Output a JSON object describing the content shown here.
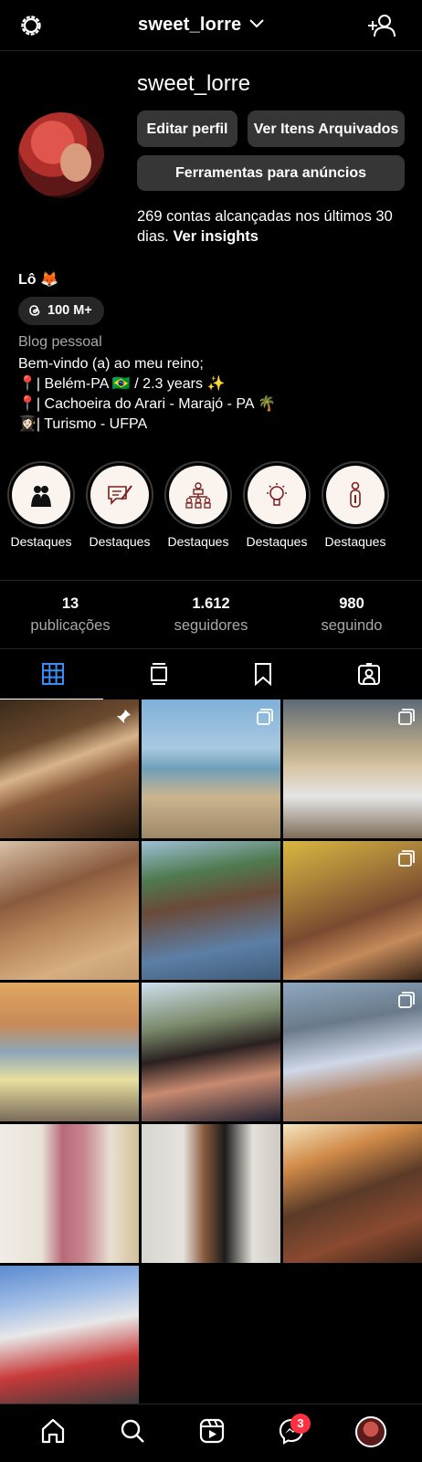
{
  "header": {
    "username": "sweet_lorre",
    "icons": [
      "settings-gear-icon",
      "chevron-down-icon",
      "add-person-icon"
    ]
  },
  "profile": {
    "display_username": "sweet_lorre",
    "edit_button": "Editar perfil",
    "archive_button": "Ver Itens Arquivados",
    "ads_button": "Ferramentas para anúncios",
    "reach_text": "269 contas alcançadas nos últimos 30 dias.",
    "insights_link": "Ver insights",
    "name": "Lô 🦊",
    "threads_count": "100 M+",
    "category": "Blog pessoal",
    "bio_lines": [
      "Bem-vindo (a) ao meu reino;",
      "📍| Belém-PA 🇧🇷 / 2.3 years ✨",
      "📍| Cachoeira do Arari - Marajó - PA 🌴",
      "👩🏻‍🎓| Turismo - UFPA"
    ]
  },
  "highlights": [
    {
      "label": "Destaques",
      "icon": "couple-icon"
    },
    {
      "label": "Destaques",
      "icon": "pen-chat-icon"
    },
    {
      "label": "Destaques",
      "icon": "people-network-icon"
    },
    {
      "label": "Destaques",
      "icon": "lightbulb-icon"
    },
    {
      "label": "Destaques",
      "icon": "person-info-icon"
    }
  ],
  "stats": [
    {
      "value": "13",
      "label": "publicações"
    },
    {
      "value": "1.612",
      "label": "seguidores"
    },
    {
      "value": "980",
      "label": "seguindo"
    }
  ],
  "tabs": [
    "grid-icon",
    "reels-icon",
    "saved-icon",
    "tagged-icon"
  ],
  "posts": [
    {
      "overlay": "pin-icon"
    },
    {
      "overlay": "carousel-icon"
    },
    {
      "overlay": "carousel-icon"
    },
    {
      "overlay": ""
    },
    {
      "overlay": ""
    },
    {
      "overlay": "carousel-icon"
    },
    {
      "overlay": ""
    },
    {
      "overlay": ""
    },
    {
      "overlay": "carousel-icon"
    },
    {
      "overlay": ""
    },
    {
      "overlay": ""
    },
    {
      "overlay": ""
    },
    {
      "overlay": ""
    }
  ],
  "bottom_nav": {
    "items": [
      "home-icon",
      "search-icon",
      "reels-icon",
      "messenger-icon",
      "profile-avatar"
    ],
    "messages_badge": "3"
  },
  "colors": {
    "background": "#000000",
    "button": "#363636",
    "muted_text": "#a8a8a8",
    "badge": "#ff3040"
  }
}
